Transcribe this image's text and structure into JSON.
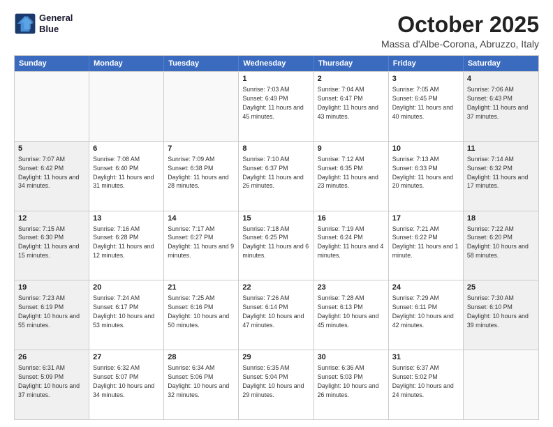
{
  "header": {
    "logo_line1": "General",
    "logo_line2": "Blue",
    "title": "October 2025",
    "subtitle": "Massa d'Albe-Corona, Abruzzo, Italy"
  },
  "weekdays": [
    "Sunday",
    "Monday",
    "Tuesday",
    "Wednesday",
    "Thursday",
    "Friday",
    "Saturday"
  ],
  "rows": [
    [
      {
        "day": "",
        "text": "",
        "empty": true
      },
      {
        "day": "",
        "text": "",
        "empty": true
      },
      {
        "day": "",
        "text": "",
        "empty": true
      },
      {
        "day": "1",
        "text": "Sunrise: 7:03 AM\nSunset: 6:49 PM\nDaylight: 11 hours and 45 minutes.",
        "empty": false,
        "shaded": false
      },
      {
        "day": "2",
        "text": "Sunrise: 7:04 AM\nSunset: 6:47 PM\nDaylight: 11 hours and 43 minutes.",
        "empty": false,
        "shaded": false
      },
      {
        "day": "3",
        "text": "Sunrise: 7:05 AM\nSunset: 6:45 PM\nDaylight: 11 hours and 40 minutes.",
        "empty": false,
        "shaded": false
      },
      {
        "day": "4",
        "text": "Sunrise: 7:06 AM\nSunset: 6:43 PM\nDaylight: 11 hours and 37 minutes.",
        "empty": false,
        "shaded": true
      }
    ],
    [
      {
        "day": "5",
        "text": "Sunrise: 7:07 AM\nSunset: 6:42 PM\nDaylight: 11 hours and 34 minutes.",
        "empty": false,
        "shaded": true
      },
      {
        "day": "6",
        "text": "Sunrise: 7:08 AM\nSunset: 6:40 PM\nDaylight: 11 hours and 31 minutes.",
        "empty": false,
        "shaded": false
      },
      {
        "day": "7",
        "text": "Sunrise: 7:09 AM\nSunset: 6:38 PM\nDaylight: 11 hours and 28 minutes.",
        "empty": false,
        "shaded": false
      },
      {
        "day": "8",
        "text": "Sunrise: 7:10 AM\nSunset: 6:37 PM\nDaylight: 11 hours and 26 minutes.",
        "empty": false,
        "shaded": false
      },
      {
        "day": "9",
        "text": "Sunrise: 7:12 AM\nSunset: 6:35 PM\nDaylight: 11 hours and 23 minutes.",
        "empty": false,
        "shaded": false
      },
      {
        "day": "10",
        "text": "Sunrise: 7:13 AM\nSunset: 6:33 PM\nDaylight: 11 hours and 20 minutes.",
        "empty": false,
        "shaded": false
      },
      {
        "day": "11",
        "text": "Sunrise: 7:14 AM\nSunset: 6:32 PM\nDaylight: 11 hours and 17 minutes.",
        "empty": false,
        "shaded": true
      }
    ],
    [
      {
        "day": "12",
        "text": "Sunrise: 7:15 AM\nSunset: 6:30 PM\nDaylight: 11 hours and 15 minutes.",
        "empty": false,
        "shaded": true
      },
      {
        "day": "13",
        "text": "Sunrise: 7:16 AM\nSunset: 6:28 PM\nDaylight: 11 hours and 12 minutes.",
        "empty": false,
        "shaded": false
      },
      {
        "day": "14",
        "text": "Sunrise: 7:17 AM\nSunset: 6:27 PM\nDaylight: 11 hours and 9 minutes.",
        "empty": false,
        "shaded": false
      },
      {
        "day": "15",
        "text": "Sunrise: 7:18 AM\nSunset: 6:25 PM\nDaylight: 11 hours and 6 minutes.",
        "empty": false,
        "shaded": false
      },
      {
        "day": "16",
        "text": "Sunrise: 7:19 AM\nSunset: 6:24 PM\nDaylight: 11 hours and 4 minutes.",
        "empty": false,
        "shaded": false
      },
      {
        "day": "17",
        "text": "Sunrise: 7:21 AM\nSunset: 6:22 PM\nDaylight: 11 hours and 1 minute.",
        "empty": false,
        "shaded": false
      },
      {
        "day": "18",
        "text": "Sunrise: 7:22 AM\nSunset: 6:20 PM\nDaylight: 10 hours and 58 minutes.",
        "empty": false,
        "shaded": true
      }
    ],
    [
      {
        "day": "19",
        "text": "Sunrise: 7:23 AM\nSunset: 6:19 PM\nDaylight: 10 hours and 55 minutes.",
        "empty": false,
        "shaded": true
      },
      {
        "day": "20",
        "text": "Sunrise: 7:24 AM\nSunset: 6:17 PM\nDaylight: 10 hours and 53 minutes.",
        "empty": false,
        "shaded": false
      },
      {
        "day": "21",
        "text": "Sunrise: 7:25 AM\nSunset: 6:16 PM\nDaylight: 10 hours and 50 minutes.",
        "empty": false,
        "shaded": false
      },
      {
        "day": "22",
        "text": "Sunrise: 7:26 AM\nSunset: 6:14 PM\nDaylight: 10 hours and 47 minutes.",
        "empty": false,
        "shaded": false
      },
      {
        "day": "23",
        "text": "Sunrise: 7:28 AM\nSunset: 6:13 PM\nDaylight: 10 hours and 45 minutes.",
        "empty": false,
        "shaded": false
      },
      {
        "day": "24",
        "text": "Sunrise: 7:29 AM\nSunset: 6:11 PM\nDaylight: 10 hours and 42 minutes.",
        "empty": false,
        "shaded": false
      },
      {
        "day": "25",
        "text": "Sunrise: 7:30 AM\nSunset: 6:10 PM\nDaylight: 10 hours and 39 minutes.",
        "empty": false,
        "shaded": true
      }
    ],
    [
      {
        "day": "26",
        "text": "Sunrise: 6:31 AM\nSunset: 5:09 PM\nDaylight: 10 hours and 37 minutes.",
        "empty": false,
        "shaded": true
      },
      {
        "day": "27",
        "text": "Sunrise: 6:32 AM\nSunset: 5:07 PM\nDaylight: 10 hours and 34 minutes.",
        "empty": false,
        "shaded": false
      },
      {
        "day": "28",
        "text": "Sunrise: 6:34 AM\nSunset: 5:06 PM\nDaylight: 10 hours and 32 minutes.",
        "empty": false,
        "shaded": false
      },
      {
        "day": "29",
        "text": "Sunrise: 6:35 AM\nSunset: 5:04 PM\nDaylight: 10 hours and 29 minutes.",
        "empty": false,
        "shaded": false
      },
      {
        "day": "30",
        "text": "Sunrise: 6:36 AM\nSunset: 5:03 PM\nDaylight: 10 hours and 26 minutes.",
        "empty": false,
        "shaded": false
      },
      {
        "day": "31",
        "text": "Sunrise: 6:37 AM\nSunset: 5:02 PM\nDaylight: 10 hours and 24 minutes.",
        "empty": false,
        "shaded": false
      },
      {
        "day": "",
        "text": "",
        "empty": true,
        "shaded": true
      }
    ]
  ]
}
